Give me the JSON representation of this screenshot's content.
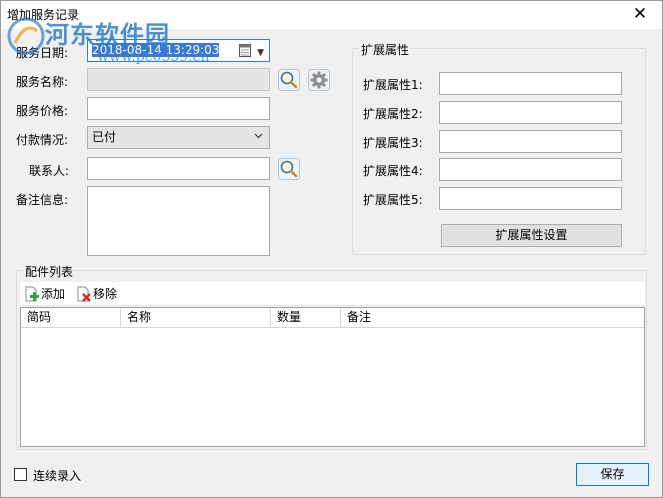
{
  "window": {
    "title": "增加服务记录",
    "close_label": "✕"
  },
  "watermark": {
    "name": "河东软件园",
    "url": "www.pc0359.cn"
  },
  "form": {
    "date_label": "服务日期:",
    "date_value": "2018-08-14 13:29:03",
    "service_name_label": "服务名称:",
    "service_name_value": "",
    "service_price_label": "服务价格:",
    "service_price_value": "",
    "payment_label": "付款情况:",
    "payment_value": "已付",
    "contact_label": "联系人:",
    "contact_value": "",
    "notes_label": "备注信息:",
    "notes_value": ""
  },
  "ext": {
    "group_title": "扩展属性",
    "attrs": [
      {
        "label": "扩展属性1:",
        "value": ""
      },
      {
        "label": "扩展属性2:",
        "value": ""
      },
      {
        "label": "扩展属性3:",
        "value": ""
      },
      {
        "label": "扩展属性4:",
        "value": ""
      },
      {
        "label": "扩展属性5:",
        "value": ""
      }
    ],
    "settings_button": "扩展属性设置"
  },
  "parts": {
    "group_title": "配件列表",
    "add_label": "添加",
    "remove_label": "移除",
    "columns": [
      "简码",
      "名称",
      "数量",
      "备注"
    ]
  },
  "footer": {
    "continuous_label": "连续录入",
    "continuous_checked": false,
    "save_label": "保存"
  },
  "colors": {
    "accent": "#0078d7",
    "selection": "#3a78d4",
    "watermark": "#2f7fc8"
  }
}
